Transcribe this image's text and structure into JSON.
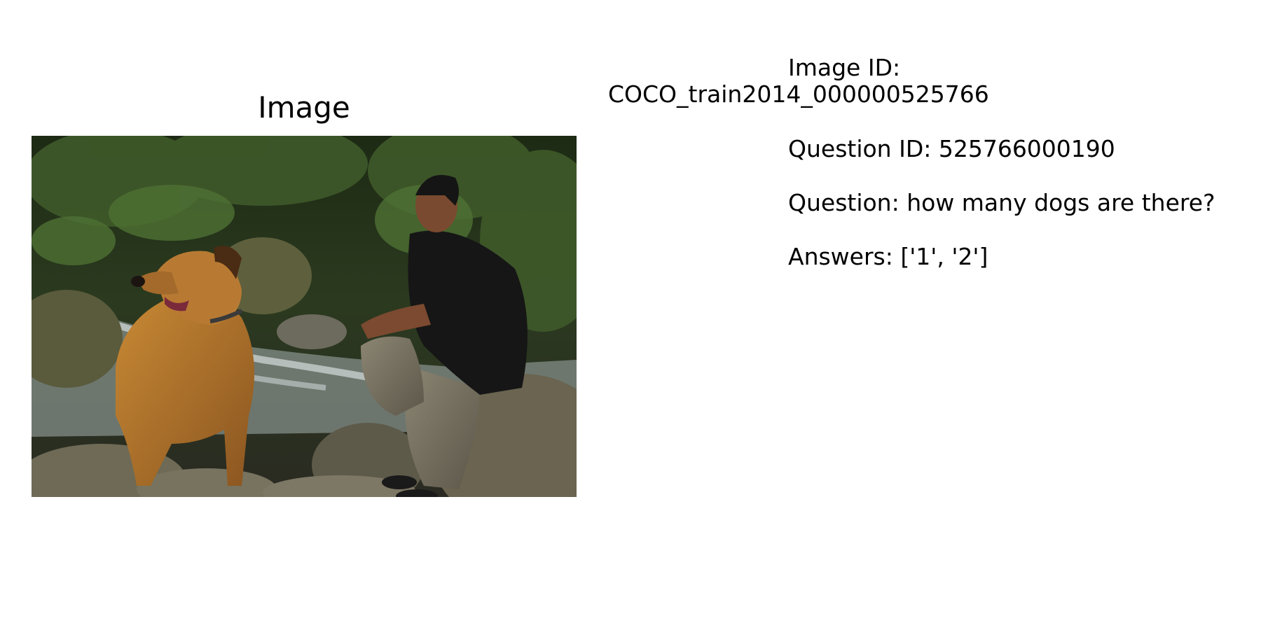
{
  "panel": {
    "title": "Image"
  },
  "info": {
    "image_id_label": "Image ID:",
    "image_id_value": "COCO_train2014_000000525766",
    "question_id": "Question ID: 525766000190",
    "question": "Question: how many dogs are there?",
    "answers": "Answers: ['1', '2']"
  },
  "colors": {
    "background": "#ffffff",
    "text": "#000000"
  }
}
